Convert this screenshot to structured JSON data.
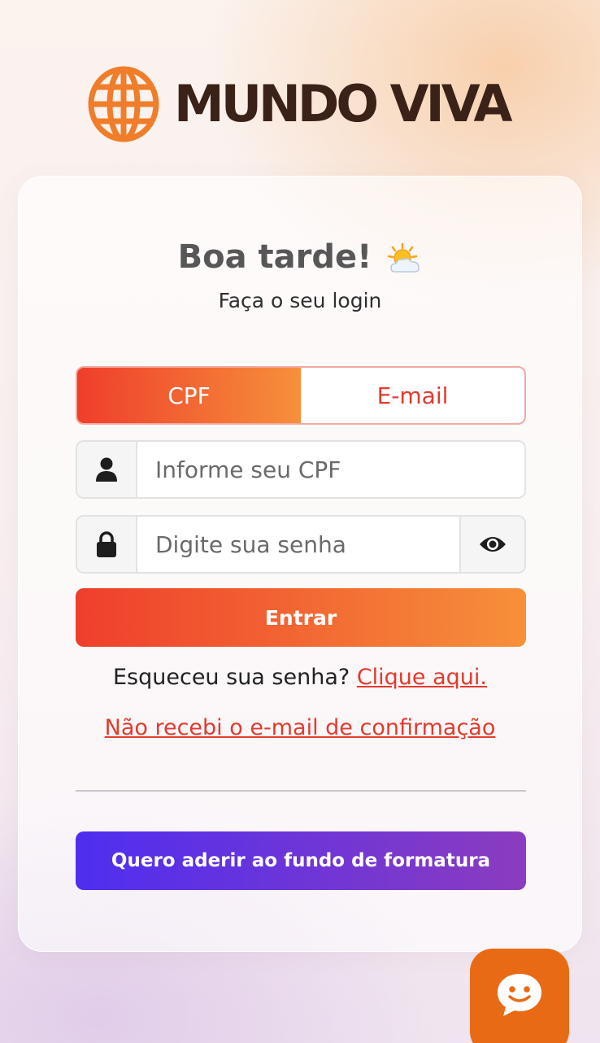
{
  "brand": {
    "name": "MUNDO VIVA"
  },
  "login": {
    "greeting": "Boa tarde!",
    "subtitle": "Faça o seu login",
    "tabs": [
      {
        "label": "CPF",
        "active": true
      },
      {
        "label": "E-mail",
        "active": false
      }
    ],
    "cpf_field": {
      "placeholder": "Informe seu CPF",
      "value": ""
    },
    "password_field": {
      "placeholder": "Digite sua senha",
      "value": ""
    },
    "submit_label": "Entrar",
    "forgot_text": "Esqueceu sua senha?",
    "forgot_link": "Clique aqui.",
    "resend_link": "Não recebi o e-mail de confirmação",
    "join_label": "Quero aderir ao fundo de formatura"
  },
  "icons": {
    "logo": "globe-icon",
    "greeting": "sun-behind-cloud-icon",
    "cpf": "user-icon",
    "password": "lock-icon",
    "toggle_password": "eye-icon",
    "chat": "chat-bubble-icon"
  },
  "colors": {
    "brand_orange": "#F07D2A",
    "brand_dark": "#3B2218",
    "accent_red": "#E23B2E",
    "gradient_primary": [
      "#EF3E2C",
      "#F6903A"
    ],
    "gradient_secondary": [
      "#4F2EF0",
      "#8B3CBF"
    ],
    "chat_button": "#E96A14"
  }
}
